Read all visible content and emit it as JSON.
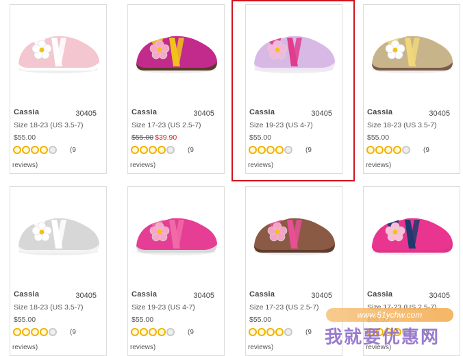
{
  "products": [
    {
      "name": "Cassia",
      "sku": "30405",
      "size": "Size 18-23 (US 3.5-7)",
      "price": "$55.00",
      "old_price": "",
      "sale_price": "",
      "reviews_count": "(9",
      "reviews_word": "reviews)",
      "color_main": "#f4c6cf",
      "color_sole": "#ffffff",
      "color_strap": "#ffffff",
      "color_flower": "#ffffff"
    },
    {
      "name": "Cassia",
      "sku": "30405",
      "size": "Size 17-23 (US 2.5-7)",
      "price": "",
      "old_price": "$55.00",
      "sale_price": "$39.90",
      "reviews_count": "(9",
      "reviews_word": "reviews)",
      "color_main": "#c22a8c",
      "color_sole": "#5a3a2a",
      "color_strap": "#f1c21b",
      "color_flower": "#f7a8c8"
    },
    {
      "name": "Cassia",
      "sku": "30405",
      "size": "Size 19-23 (US 4-7)",
      "price": "$55.00",
      "old_price": "",
      "sale_price": "",
      "reviews_count": "(9",
      "reviews_word": "reviews)",
      "color_main": "#d8b9e6",
      "color_sole": "#efe6f6",
      "color_strap": "#e23c8c",
      "color_flower": "#f2b7da"
    },
    {
      "name": "Cassia",
      "sku": "30405",
      "size": "Size 18-23 (US 3.5-7)",
      "price": "$55.00",
      "old_price": "",
      "sale_price": "",
      "reviews_count": "(9",
      "reviews_word": "reviews)",
      "color_main": "#c8b48a",
      "color_sole": "#7a5a48",
      "color_strap": "#f0d77a",
      "color_flower": "#ffffff"
    },
    {
      "name": "Cassia",
      "sku": "30405",
      "size": "Size 18-23 (US 3.5-7)",
      "price": "$55.00",
      "old_price": "",
      "sale_price": "",
      "reviews_count": "(9",
      "reviews_word": "reviews)",
      "color_main": "#d7d7d7",
      "color_sole": "#f4f4f4",
      "color_strap": "#ffffff",
      "color_flower": "#ffffff"
    },
    {
      "name": "Cassia",
      "sku": "30405",
      "size": "Size 19-23 (US 4-7)",
      "price": "$55.00",
      "old_price": "",
      "sale_price": "",
      "reviews_count": "(9",
      "reviews_word": "reviews)",
      "color_main": "#e63d95",
      "color_sole": "#d8d8d8",
      "color_strap": "#f06aa8",
      "color_flower": "#f7a8c8"
    },
    {
      "name": "Cassia",
      "sku": "30405",
      "size": "Size 17-23 (US 2.5-7)",
      "price": "$55.00",
      "old_price": "",
      "sale_price": "",
      "reviews_count": "(9",
      "reviews_word": "reviews)",
      "color_main": "#8b5a44",
      "color_sole": "#5e3b2c",
      "color_strap": "#e84f95",
      "color_flower": "#f3a3c4"
    },
    {
      "name": "Cassia",
      "sku": "30405",
      "size": "Size 17-23 (US 2.5-7)",
      "price": "$55.00",
      "old_price": "",
      "sale_price": "",
      "reviews_count": "(9",
      "reviews_word": "reviews)",
      "color_main": "#e9358f",
      "color_sole": "#e2338b",
      "color_strap": "#1f3a6e",
      "color_flower": "#f7c0d8"
    }
  ],
  "highlighted_index": 2,
  "watermark": {
    "url": "www.51ychw.com",
    "text": "我就要优惠网"
  },
  "colors": {
    "star": "#f2b200",
    "sale": "#e2171f",
    "highlight": "#d3121d"
  }
}
